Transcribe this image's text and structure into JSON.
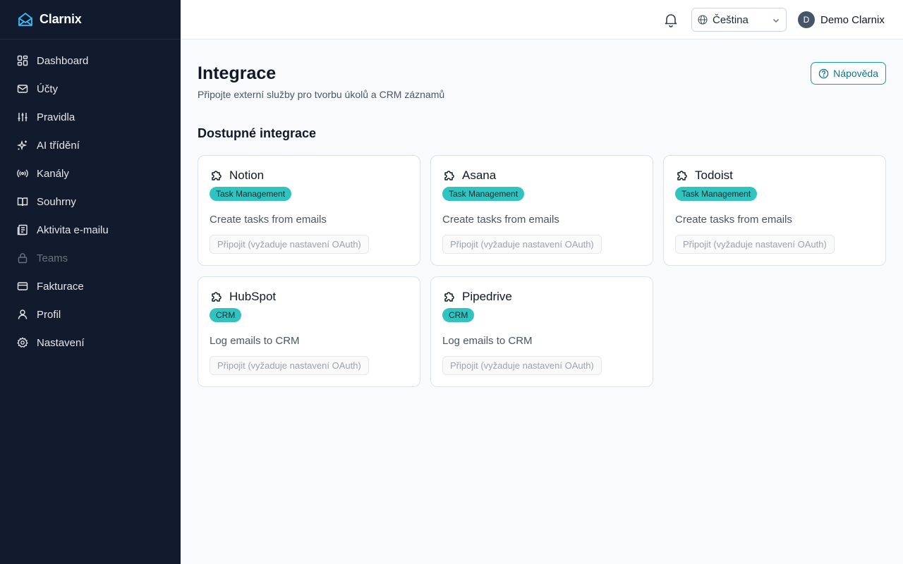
{
  "app": {
    "name": "Clarnix"
  },
  "sidebar": {
    "items": [
      {
        "label": "Dashboard",
        "icon": "dashboard-icon"
      },
      {
        "label": "Účty",
        "icon": "mail-icon"
      },
      {
        "label": "Pravidla",
        "icon": "sliders-icon"
      },
      {
        "label": "AI třídění",
        "icon": "sparkles-icon"
      },
      {
        "label": "Kanály",
        "icon": "radio-icon"
      },
      {
        "label": "Souhrny",
        "icon": "book-icon"
      },
      {
        "label": "Aktivita e-mailu",
        "icon": "activity-icon"
      },
      {
        "label": "Teams",
        "icon": "lock-icon",
        "disabled": true
      },
      {
        "label": "Fakturace",
        "icon": "credit-card-icon"
      },
      {
        "label": "Profil",
        "icon": "user-icon"
      },
      {
        "label": "Nastavení",
        "icon": "gear-icon"
      }
    ]
  },
  "topbar": {
    "language": "Čeština",
    "user": {
      "initial": "D",
      "name": "Demo Clarnix"
    }
  },
  "page": {
    "title": "Integrace",
    "subtitle": "Připojte externí služby pro tvorbu úkolů a CRM záznamů",
    "help_label": "Nápověda",
    "section_title": "Dostupné integrace"
  },
  "integrations": [
    {
      "name": "Notion",
      "category": "Task Management",
      "description": "Create tasks from emails",
      "connect_label": "Připojit (vyžaduje nastavení OAuth)"
    },
    {
      "name": "Asana",
      "category": "Task Management",
      "description": "Create tasks from emails",
      "connect_label": "Připojit (vyžaduje nastavení OAuth)"
    },
    {
      "name": "Todoist",
      "category": "Task Management",
      "description": "Create tasks from emails",
      "connect_label": "Připojit (vyžaduje nastavení OAuth)"
    },
    {
      "name": "HubSpot",
      "category": "CRM",
      "description": "Log emails to CRM",
      "connect_label": "Připojit (vyžaduje nastavení OAuth)"
    },
    {
      "name": "Pipedrive",
      "category": "CRM",
      "description": "Log emails to CRM",
      "connect_label": "Připojit (vyžaduje nastavení OAuth)"
    }
  ],
  "colors": {
    "sidebar_bg": "#121a2e",
    "accent": "#2fc4c0",
    "brand_icon": "#38bdf8"
  }
}
